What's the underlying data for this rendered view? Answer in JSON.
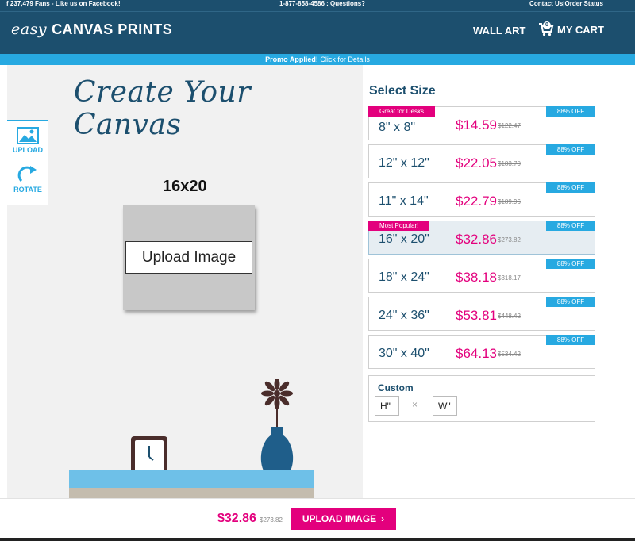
{
  "topbar": {
    "fans": "237,479 Fans - Like us on Facebook!",
    "phone": "1-877-858-4586 : Questions?",
    "contact": "Contact Us",
    "separator": " | ",
    "order_status": "Order Status"
  },
  "header": {
    "logo_script": "easy",
    "logo_text": "CANVAS PRINTS",
    "wall_art": "WALL ART",
    "my_cart": "MY CART",
    "cart_count": "0"
  },
  "promo": {
    "bold": "Promo Applied!",
    "link": " Click for Details"
  },
  "editor": {
    "title": "Create Your Canvas",
    "upload_tool": "UPLOAD",
    "rotate_tool": "ROTATE",
    "size_label": "16x20",
    "upload_image_button": "Upload Image"
  },
  "sizes": {
    "heading": "Select Size",
    "options": [
      {
        "dim": "8\" x 8\"",
        "price": "$14.59",
        "orig": "$122.47",
        "off": "88% OFF",
        "tag": "Great for Desks"
      },
      {
        "dim": "12\" x 12\"",
        "price": "$22.05",
        "orig": "$183.70",
        "off": "88% OFF",
        "tag": ""
      },
      {
        "dim": "11\" x 14\"",
        "price": "$22.79",
        "orig": "$189.96",
        "off": "88% OFF",
        "tag": ""
      },
      {
        "dim": "16\" x 20\"",
        "price": "$32.86",
        "orig": "$273.82",
        "off": "88% OFF",
        "tag": "Most Popular!",
        "selected": true
      },
      {
        "dim": "18\" x 24\"",
        "price": "$38.18",
        "orig": "$318.17",
        "off": "88% OFF",
        "tag": ""
      },
      {
        "dim": "24\" x 36\"",
        "price": "$53.81",
        "orig": "$448.42",
        "off": "88% OFF",
        "tag": ""
      },
      {
        "dim": "30\" x 40\"",
        "price": "$64.13",
        "orig": "$534.42",
        "off": "88% OFF",
        "tag": ""
      }
    ],
    "custom": {
      "title": "Custom",
      "h_placeholder": "H\"",
      "times": "×",
      "w_placeholder": "W\""
    }
  },
  "footer": {
    "price": "$32.86",
    "orig": "$273.82",
    "button": "UPLOAD IMAGE",
    "chevron": "›"
  },
  "colors": {
    "navy": "#1c4f6e",
    "sky": "#27a9e1",
    "magenta": "#e3007d"
  }
}
